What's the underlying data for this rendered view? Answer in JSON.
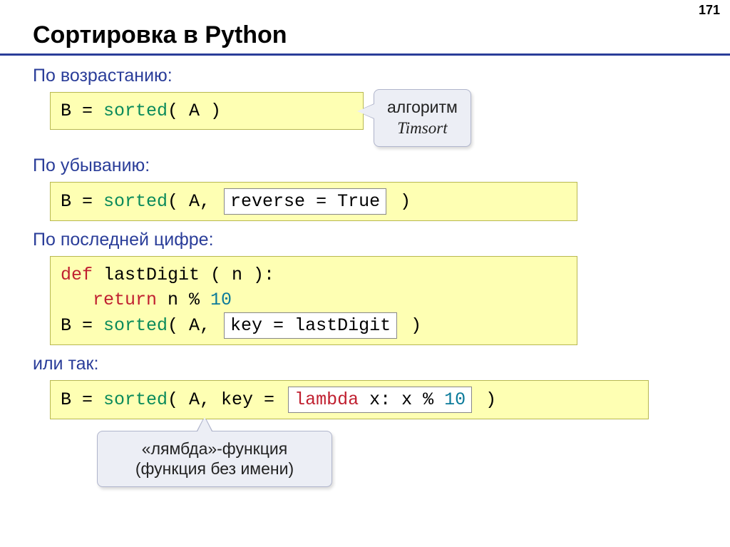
{
  "page_number": "171",
  "title": "Сортировка в Python",
  "sections": {
    "ascending": {
      "label": "По возрастанию:",
      "code_prefix": "B = ",
      "code_fn": "sorted",
      "code_args": "( A )"
    },
    "descending": {
      "label": "По убыванию:",
      "code_prefix": "B = ",
      "code_fn": "sorted",
      "code_open": "( A, ",
      "code_inset": "reverse = True",
      "code_close": " )"
    },
    "lastdigit": {
      "label": "По последней цифре:",
      "code_def": "def",
      "code_defname": " lastDigit ( n ):",
      "code_return": "return",
      "code_retexpr": " n % ",
      "code_ten": "10",
      "code_prefix": "B = ",
      "code_fn": "sorted",
      "code_open": "( A, ",
      "code_inset": "key = lastDigit",
      "code_close": " )"
    },
    "lambda": {
      "label": "или так:",
      "code_prefix": "B = ",
      "code_fn": "sorted",
      "code_open": "( A, key = ",
      "code_inset_kw": "lambda",
      "code_inset_rest": " x: x % ",
      "code_inset_ten": "10",
      "code_close": "  )"
    }
  },
  "callouts": {
    "timsort_line1": "алгоритм",
    "timsort_line2": "Timsort",
    "lambda_line1": "«лямбда»-функция",
    "lambda_line2": "(функция без имени)"
  }
}
